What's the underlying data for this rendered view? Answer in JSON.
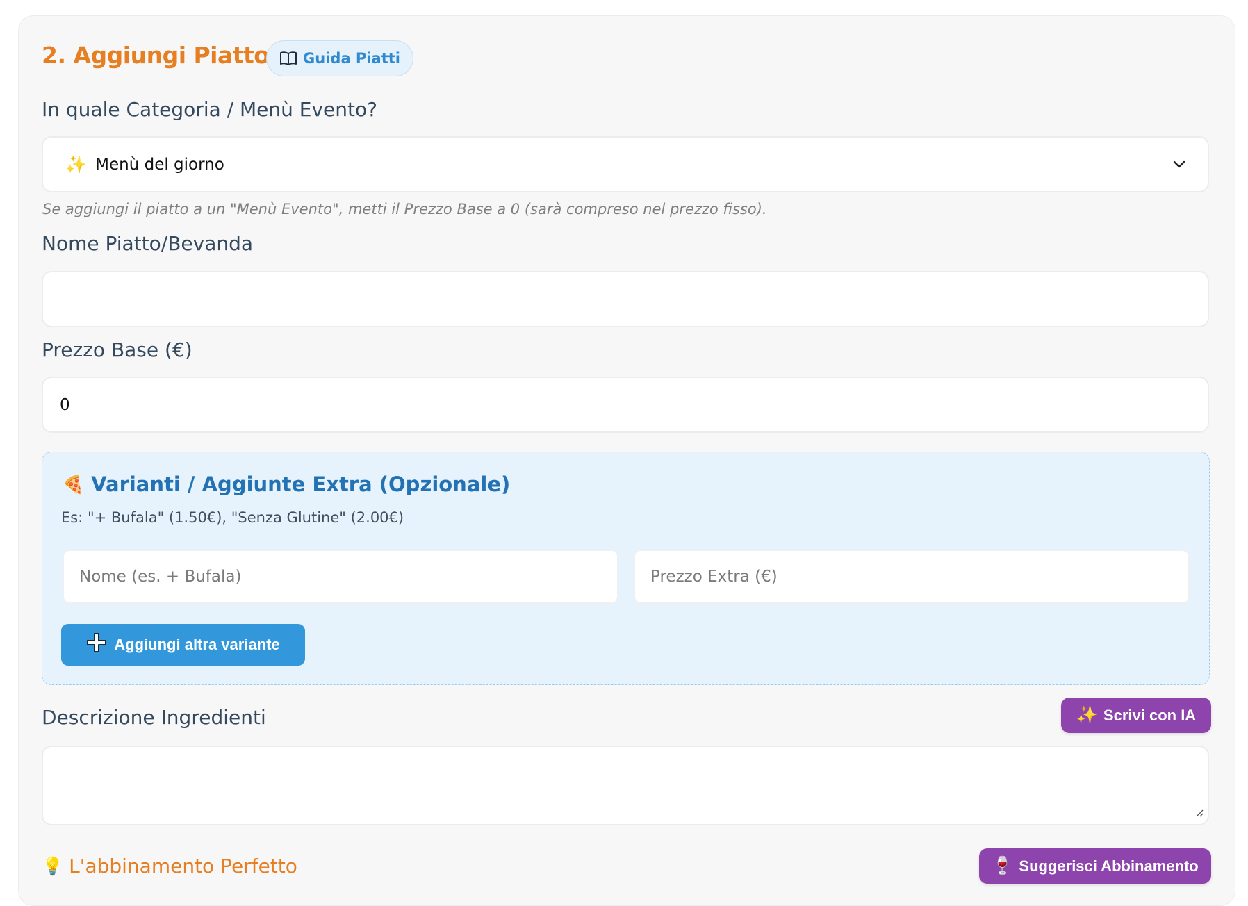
{
  "section": {
    "title": "2. Aggiungi Piatto",
    "guide_button": "Guida Piatti"
  },
  "category": {
    "label": "In quale Categoria / Menù Evento?",
    "selected_emoji": "✨",
    "selected_value": "Menù del giorno",
    "hint": "Se aggiungi il piatto a un \"Menù Evento\", metti il Prezzo Base a 0 (sarà compreso nel prezzo fisso)."
  },
  "dish_name": {
    "label": "Nome Piatto/Bevanda",
    "value": ""
  },
  "base_price": {
    "label": "Prezzo Base (€)",
    "value": "0"
  },
  "variants": {
    "emoji": "🍕",
    "title": "Varianti / Aggiunte Extra (Opzionale)",
    "example": "Es: \"+ Bufala\" (1.50€), \"Senza Glutine\" (2.00€)",
    "name_placeholder": "Nome (es. + Bufala)",
    "price_placeholder": "Prezzo Extra (€)",
    "add_button": "Aggiungi altra variante"
  },
  "description": {
    "label": "Descrizione Ingredienti",
    "ai_button_emoji": "✨",
    "ai_button": "Scrivi con IA",
    "value": ""
  },
  "pairing": {
    "emoji": "💡",
    "label": "L'abbinamento Perfetto",
    "button_emoji": "🍷",
    "button": "Suggerisci Abbinamento"
  },
  "colors": {
    "accent_orange": "#e67e22",
    "accent_blue": "#3397dc",
    "accent_purple": "#8e44ad"
  }
}
